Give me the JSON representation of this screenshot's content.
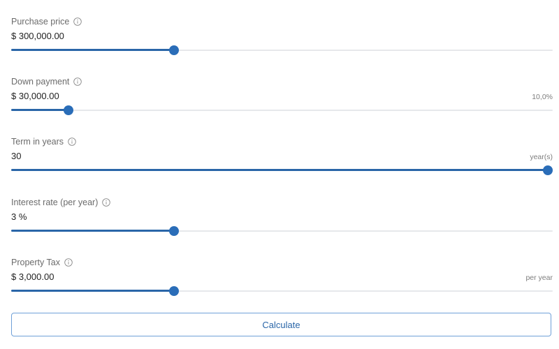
{
  "fields": [
    {
      "label": "Purchase price",
      "value": "$ 300,000.00",
      "suffix": "",
      "slider_level": 0.303
    },
    {
      "label": "Down payment",
      "value": "$ 30,000.00",
      "suffix": "10,0%",
      "slider_level": 0.107
    },
    {
      "label": "Term in years",
      "value": "30",
      "suffix": "year(s)",
      "slider_level": 1.0
    },
    {
      "label": "Interest rate (per year)",
      "value": "3 %",
      "suffix": "",
      "slider_level": 0.303
    },
    {
      "label": "Property Tax",
      "value": "$ 3,000.00",
      "suffix": "per year",
      "slider_level": 0.303
    }
  ],
  "calculate_label": "Calculate",
  "colors": {
    "accent": "#2a6db8",
    "track": "#e6e8eb",
    "label": "#6b6b6b"
  },
  "icons": {
    "info": "info-icon"
  }
}
